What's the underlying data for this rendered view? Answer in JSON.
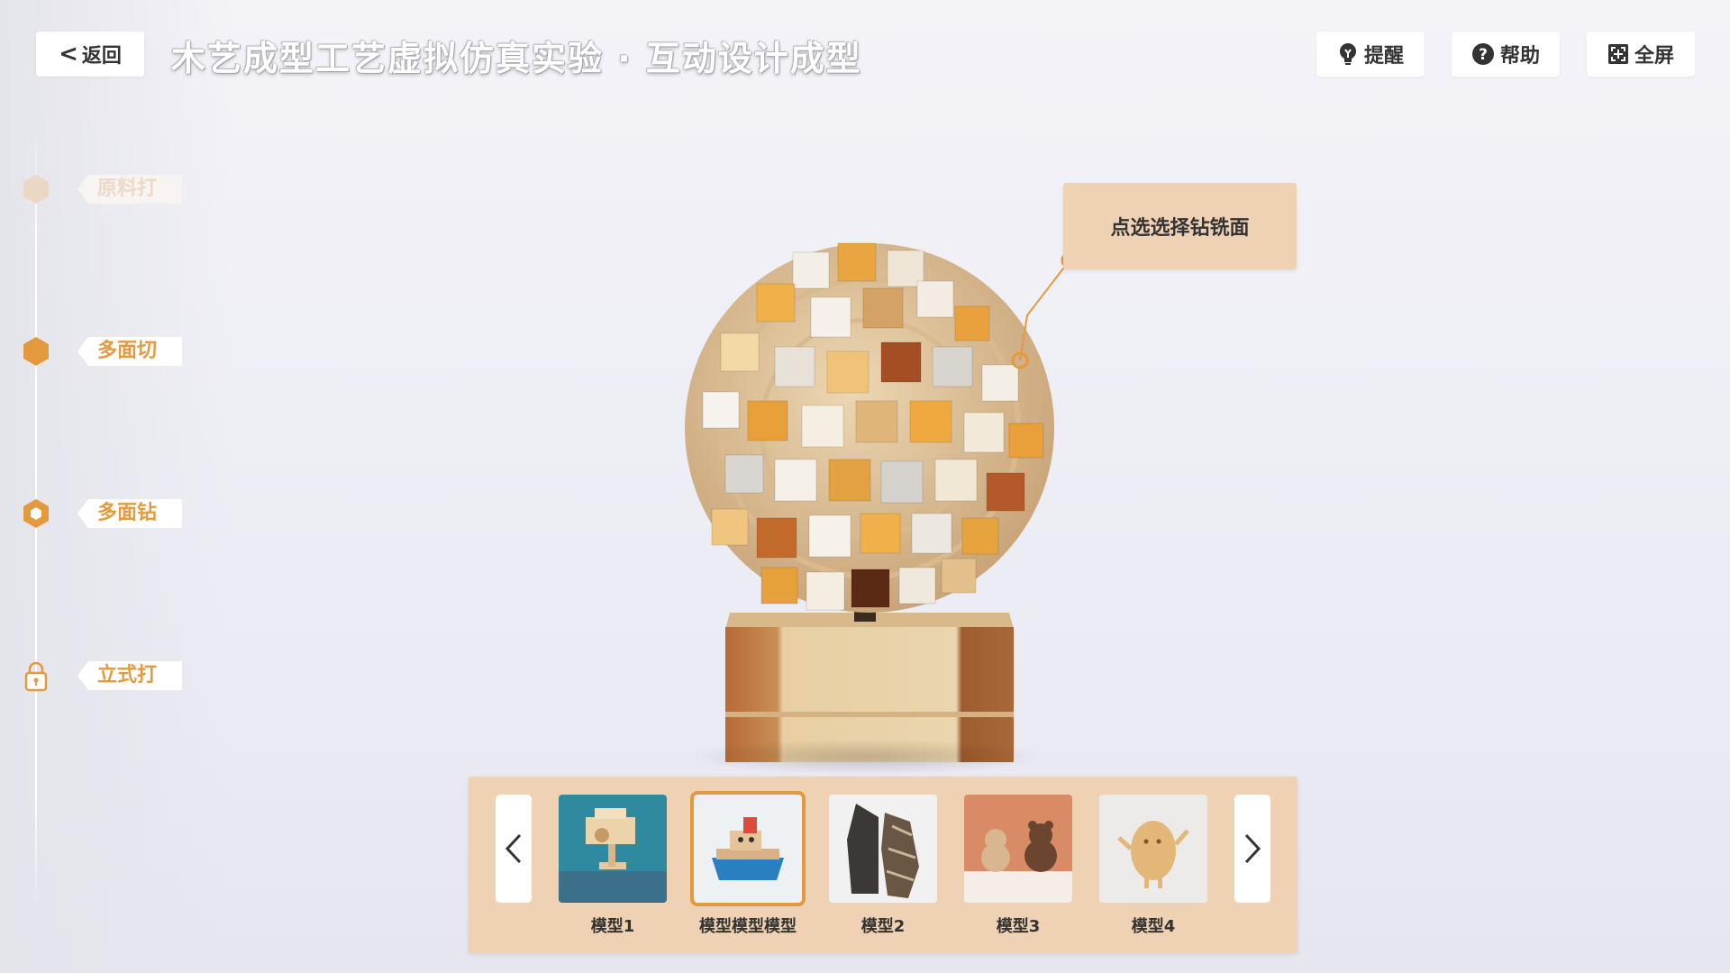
{
  "header": {
    "back_label": "返回",
    "title": "木艺成型工艺虚拟仿真实验 · 互动设计成型",
    "buttons": [
      {
        "label": "提醒",
        "icon": "lightbulb-icon"
      },
      {
        "label": "帮助",
        "icon": "question-circle-icon"
      },
      {
        "label": "全屏",
        "icon": "fullscreen-icon"
      }
    ]
  },
  "steps": [
    {
      "label": "原料打孔",
      "state": "disabled",
      "icon": "hexagon-icon"
    },
    {
      "label": "多面切割",
      "state": "done",
      "icon": "hexagon-filled-icon"
    },
    {
      "label": "多面钻铣",
      "state": "current",
      "icon": "hexagon-ring-icon"
    },
    {
      "label": "立式打磨",
      "state": "locked",
      "icon": "lock-icon"
    }
  ],
  "callout": {
    "text": "点选选择钻铣面"
  },
  "carousel": {
    "items": [
      {
        "label": "模型1",
        "selected": false
      },
      {
        "label": "模型模型模型",
        "selected": true
      },
      {
        "label": "模型2",
        "selected": false
      },
      {
        "label": "模型3",
        "selected": false
      },
      {
        "label": "模型4",
        "selected": false
      }
    ]
  },
  "colors": {
    "accent": "#e5993e",
    "tray": "#efd2b3",
    "faded": "#edd9c8"
  }
}
